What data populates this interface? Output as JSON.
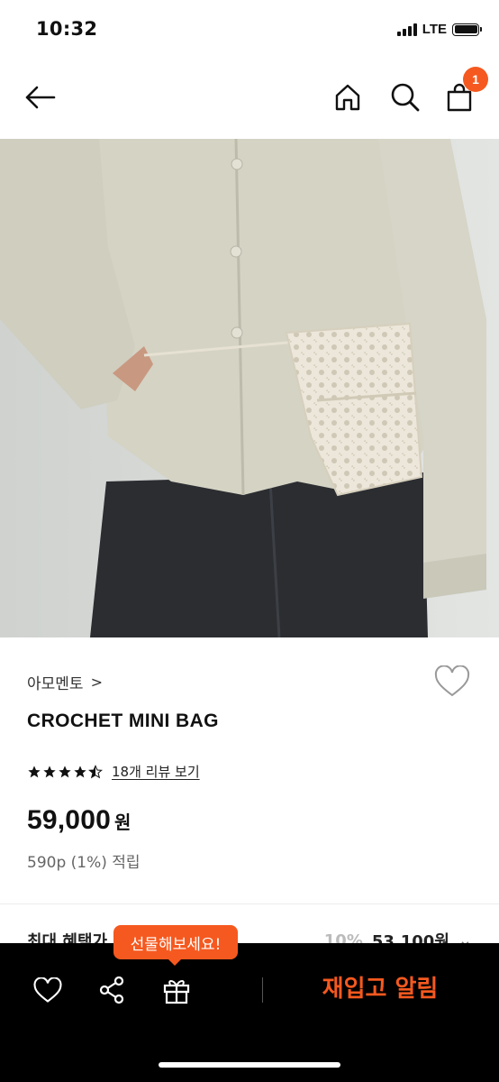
{
  "status_bar": {
    "time": "10:32",
    "network": "LTE"
  },
  "nav": {
    "cart_count": "1"
  },
  "product": {
    "brand": "아모멘토",
    "brand_chevron": ">",
    "title": "CROCHET MINI BAG",
    "rating": 4.5,
    "review_link": "18개 리뷰 보기",
    "price": "59,000",
    "currency": "원",
    "points": "590p (1%) 적립"
  },
  "benefit": {
    "label": "최대 혜택가",
    "discount": "10%",
    "price": "53,100원"
  },
  "bottom_bar": {
    "tooltip": "선물해보세요!",
    "restock_label": "재입고 알림"
  },
  "colors": {
    "accent": "#f5591f",
    "bottom_bar": "#000000"
  },
  "icons": [
    "back-arrow-icon",
    "home-icon",
    "search-icon",
    "shopping-bag-icon",
    "heart-icon",
    "share-icon",
    "gift-icon",
    "star-icon",
    "chevron-down-icon"
  ]
}
